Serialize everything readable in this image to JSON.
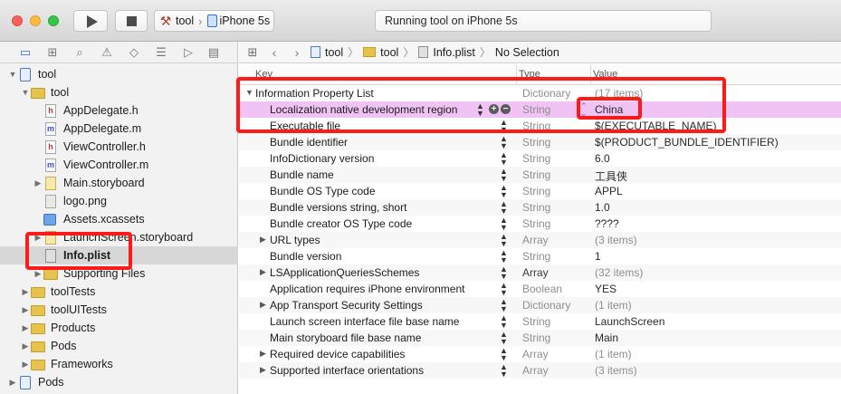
{
  "toolbar": {
    "scheme_target": "tool",
    "scheme_device": "iPhone 5s",
    "activity_text": "Running tool on iPhone 5s"
  },
  "navigator": {
    "items": [
      {
        "label": "tool",
        "kind": "project",
        "indent": 0,
        "disclosure": "open"
      },
      {
        "label": "tool",
        "kind": "folder",
        "indent": 1,
        "disclosure": "open"
      },
      {
        "label": "AppDelegate.h",
        "kind": "h",
        "indent": 2,
        "disclosure": ""
      },
      {
        "label": "AppDelegate.m",
        "kind": "m",
        "indent": 2,
        "disclosure": ""
      },
      {
        "label": "ViewController.h",
        "kind": "h",
        "indent": 2,
        "disclosure": ""
      },
      {
        "label": "ViewController.m",
        "kind": "m",
        "indent": 2,
        "disclosure": ""
      },
      {
        "label": "Main.storyboard",
        "kind": "sb",
        "indent": 2,
        "disclosure": "closed"
      },
      {
        "label": "logo.png",
        "kind": "img",
        "indent": 2,
        "disclosure": ""
      },
      {
        "label": "Assets.xcassets",
        "kind": "assets",
        "indent": 2,
        "disclosure": ""
      },
      {
        "label": "LaunchScreen.storyboard",
        "kind": "sb",
        "indent": 2,
        "disclosure": "closed"
      },
      {
        "label": "Info.plist",
        "kind": "plist",
        "indent": 2,
        "disclosure": "",
        "selected": true
      },
      {
        "label": "Supporting Files",
        "kind": "folder",
        "indent": 2,
        "disclosure": "closed"
      },
      {
        "label": "toolTests",
        "kind": "folder",
        "indent": 1,
        "disclosure": "closed"
      },
      {
        "label": "toolUITests",
        "kind": "folder",
        "indent": 1,
        "disclosure": "closed"
      },
      {
        "label": "Products",
        "kind": "folder",
        "indent": 1,
        "disclosure": "closed"
      },
      {
        "label": "Pods",
        "kind": "folder",
        "indent": 1,
        "disclosure": "closed"
      },
      {
        "label": "Frameworks",
        "kind": "folder",
        "indent": 1,
        "disclosure": "closed"
      },
      {
        "label": "Pods",
        "kind": "project",
        "indent": 0,
        "disclosure": "closed"
      }
    ]
  },
  "jumpbar": {
    "crumbs": [
      "tool",
      "tool",
      "Info.plist",
      "No Selection"
    ]
  },
  "plist": {
    "columns": {
      "key": "Key",
      "type": "Type",
      "value": "Value"
    },
    "rows": [
      {
        "key": "Information Property List",
        "type": "Dictionary",
        "value": "(17 items)",
        "level": 0,
        "disclosure": "open",
        "dim": true
      },
      {
        "key": "Localization native development region",
        "type": "String",
        "value": "China",
        "level": 1,
        "highlight": true
      },
      {
        "key": "Executable file",
        "type": "String",
        "value": "$(EXECUTABLE_NAME)",
        "level": 1
      },
      {
        "key": "Bundle identifier",
        "type": "String",
        "value": "$(PRODUCT_BUNDLE_IDENTIFIER)",
        "level": 1
      },
      {
        "key": "InfoDictionary version",
        "type": "String",
        "value": "6.0",
        "level": 1
      },
      {
        "key": "Bundle name",
        "type": "String",
        "value": "工具侠",
        "level": 1
      },
      {
        "key": "Bundle OS Type code",
        "type": "String",
        "value": "APPL",
        "level": 1
      },
      {
        "key": "Bundle versions string, short",
        "type": "String",
        "value": "1.0",
        "level": 1
      },
      {
        "key": "Bundle creator OS Type code",
        "type": "String",
        "value": "????",
        "level": 1
      },
      {
        "key": "URL types",
        "type": "Array",
        "value": "(3 items)",
        "level": 1,
        "disclosure": "closed",
        "dim": true
      },
      {
        "key": "Bundle version",
        "type": "String",
        "value": "1",
        "level": 1
      },
      {
        "key": "LSApplicationQueriesSchemes",
        "type": "Array",
        "value": "(32 items)",
        "level": 1,
        "disclosure": "closed",
        "dim": true,
        "darktype": true
      },
      {
        "key": "Application requires iPhone environment",
        "type": "Boolean",
        "value": "YES",
        "level": 1
      },
      {
        "key": "App Transport Security Settings",
        "type": "Dictionary",
        "value": "(1 item)",
        "level": 1,
        "disclosure": "closed",
        "dim": true
      },
      {
        "key": "Launch screen interface file base name",
        "type": "String",
        "value": "LaunchScreen",
        "level": 1
      },
      {
        "key": "Main storyboard file base name",
        "type": "String",
        "value": "Main",
        "level": 1
      },
      {
        "key": "Required device capabilities",
        "type": "Array",
        "value": "(1 item)",
        "level": 1,
        "disclosure": "closed",
        "dim": true
      },
      {
        "key": "Supported interface orientations",
        "type": "Array",
        "value": "(3 items)",
        "level": 1,
        "disclosure": "closed",
        "dim": true
      }
    ]
  },
  "colors": {
    "highlight_row": "#f0c3f4",
    "annotation_red": "#ff1a1a",
    "selection": "#d7d7d7"
  }
}
